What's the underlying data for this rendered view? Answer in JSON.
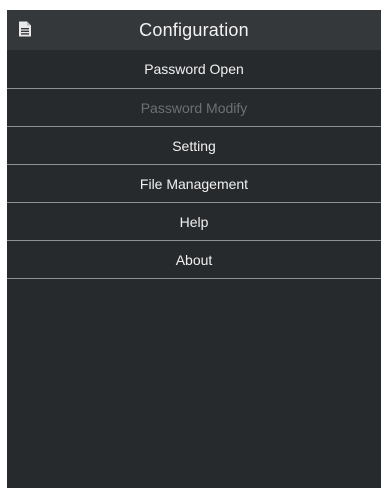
{
  "dialog": {
    "title": "Configuration",
    "title_icon": "document-icon"
  },
  "menu": {
    "items": [
      {
        "label": "Password Open",
        "enabled": true
      },
      {
        "label": "Password Modify",
        "enabled": false
      },
      {
        "label": "Setting",
        "enabled": true
      },
      {
        "label": "File Management",
        "enabled": true
      },
      {
        "label": "Help",
        "enabled": true
      },
      {
        "label": "About",
        "enabled": true
      }
    ]
  },
  "colors": {
    "background": "#272a2d",
    "title_bar": "#35383b",
    "text": "#f0f0f0",
    "disabled_text": "#6c7074",
    "divider": "#8e9296"
  }
}
